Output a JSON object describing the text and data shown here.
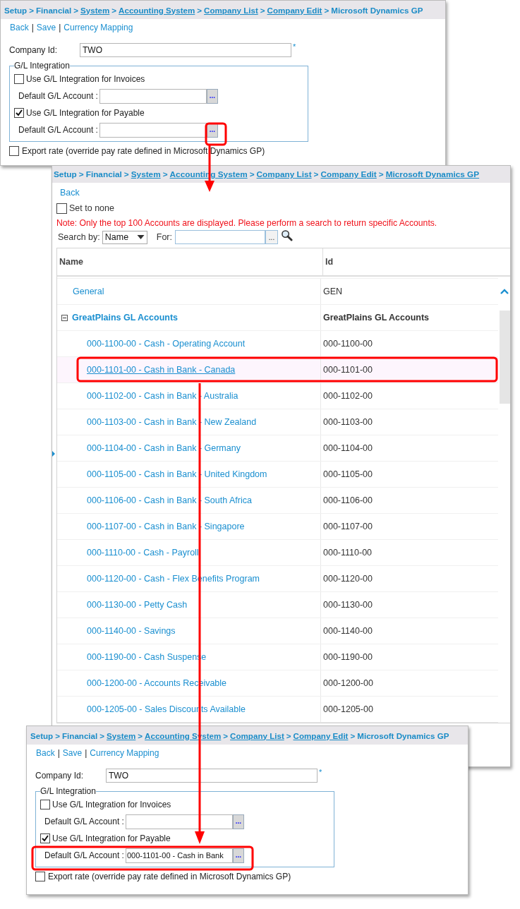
{
  "windows": [
    {
      "kind": "form",
      "breadcrumb": [
        {
          "text": "Setup",
          "link": false
        },
        {
          "text": "Financial",
          "link": false
        },
        {
          "text": "System",
          "link": true
        },
        {
          "text": "Accounting System",
          "link": true
        },
        {
          "text": "Company List",
          "link": true
        },
        {
          "text": "Company Edit",
          "link": true
        },
        {
          "text": "Microsoft Dynamics GP",
          "link": false
        }
      ],
      "separator": ">",
      "actions": [
        "Back",
        "Save",
        "Currency Mapping"
      ],
      "action_separator": "|",
      "company_id": {
        "label": "Company Id:",
        "value": "TWO",
        "required_mark": "*"
      },
      "gl_integration": {
        "legend": "G/L Integration",
        "sections": [
          {
            "label": "Use G/L Integration for Invoices",
            "checked": false,
            "account_label": "Default G/L Account :",
            "browse": "..."
          },
          {
            "label": "Use G/L Integration for Payable",
            "checked": true,
            "account_label": "Default G/L Account :",
            "browse": "..."
          }
        ]
      },
      "export_rate": {
        "label": "Export rate (override pay rate defined in Microsoft Dynamics GP)",
        "checked": false
      }
    },
    {
      "kind": "picker",
      "breadcrumb": [
        {
          "text": "Setup",
          "link": false
        },
        {
          "text": "Financial",
          "link": false
        },
        {
          "text": "System",
          "link": true
        },
        {
          "text": "Accounting System",
          "link": true
        },
        {
          "text": "Company List",
          "link": true
        },
        {
          "text": "Company Edit",
          "link": true
        },
        {
          "text": "Microsoft Dynamics GP",
          "link": true
        }
      ],
      "separator": ">",
      "actions": [
        "Back"
      ],
      "set_to_none": {
        "label": "Set to none",
        "checked": false
      },
      "note": "Note: Only the top 100 Accounts are displayed. Please perform a search to return specific Accounts.",
      "search": {
        "label": "Search by:",
        "field": "Name",
        "for_label": "For:",
        "browse": "..."
      },
      "table": {
        "columns": [
          "Name",
          "Id"
        ],
        "rows": [
          {
            "name": "General",
            "id": "GEN",
            "selected": false
          },
          {
            "name": "GreatPlains GL Accounts",
            "id": "GreatPlains GL Accounts",
            "selected": false,
            "expanded": true,
            "children": [
              {
                "name": "000-1100-00 - Cash - Operating Account",
                "id": "000-1100-00",
                "selected": false
              },
              {
                "name": "000-1101-00 - Cash in Bank - Canada",
                "id": "000-1101-00",
                "selected": true
              },
              {
                "name": "000-1102-00 - Cash in Bank - Australia",
                "id": "000-1102-00",
                "selected": false
              },
              {
                "name": "000-1103-00 - Cash in Bank - New Zealand",
                "id": "000-1103-00",
                "selected": false
              },
              {
                "name": "000-1104-00 - Cash in Bank - Germany",
                "id": "000-1104-00",
                "selected": false
              },
              {
                "name": "000-1105-00 - Cash in Bank - United Kingdom",
                "id": "000-1105-00",
                "selected": false
              },
              {
                "name": "000-1106-00 - Cash in Bank - South Africa",
                "id": "000-1106-00",
                "selected": false
              },
              {
                "name": "000-1107-00 - Cash in Bank - Singapore",
                "id": "000-1107-00",
                "selected": false
              },
              {
                "name": "000-1110-00 - Cash - Payroll",
                "id": "000-1110-00",
                "selected": false
              },
              {
                "name": "000-1120-00 - Cash - Flex Benefits Program",
                "id": "000-1120-00",
                "selected": false
              },
              {
                "name": "000-1130-00 - Petty Cash",
                "id": "000-1130-00",
                "selected": false
              },
              {
                "name": "000-1140-00 - Savings",
                "id": "000-1140-00",
                "selected": false
              },
              {
                "name": "000-1190-00 - Cash Suspense",
                "id": "000-1190-00",
                "selected": false
              },
              {
                "name": "000-1200-00 - Accounts Receivable",
                "id": "000-1200-00",
                "selected": false
              },
              {
                "name": "000-1205-00 - Sales Discounts Available",
                "id": "000-1205-00",
                "selected": false
              }
            ]
          }
        ]
      }
    },
    {
      "kind": "form",
      "breadcrumb": [
        {
          "text": "Setup",
          "link": false
        },
        {
          "text": "Financial",
          "link": false
        },
        {
          "text": "System",
          "link": true
        },
        {
          "text": "Accounting System",
          "link": true
        },
        {
          "text": "Company List",
          "link": true
        },
        {
          "text": "Company Edit",
          "link": true
        },
        {
          "text": "Microsoft Dynamics GP",
          "link": false
        }
      ],
      "separator": ">",
      "actions": [
        "Back",
        "Save",
        "Currency Mapping"
      ],
      "action_separator": "|",
      "company_id": {
        "label": "Company Id:",
        "value": "TWO",
        "required_mark": "*"
      },
      "gl_integration": {
        "legend": "G/L Integration",
        "sections": [
          {
            "label": "Use G/L Integration for Invoices",
            "checked": false,
            "account_label": "Default G/L Account :",
            "browse": "..."
          },
          {
            "label": "Use G/L Integration for Payable",
            "checked": true,
            "account_label": "Default G/L Account :",
            "account_value": "000-1101-00 - Cash in Bank",
            "browse": "..."
          }
        ]
      },
      "export_rate": {
        "label": "Export rate (override pay rate defined in Microsoft Dynamics GP)",
        "checked": false
      }
    }
  ]
}
